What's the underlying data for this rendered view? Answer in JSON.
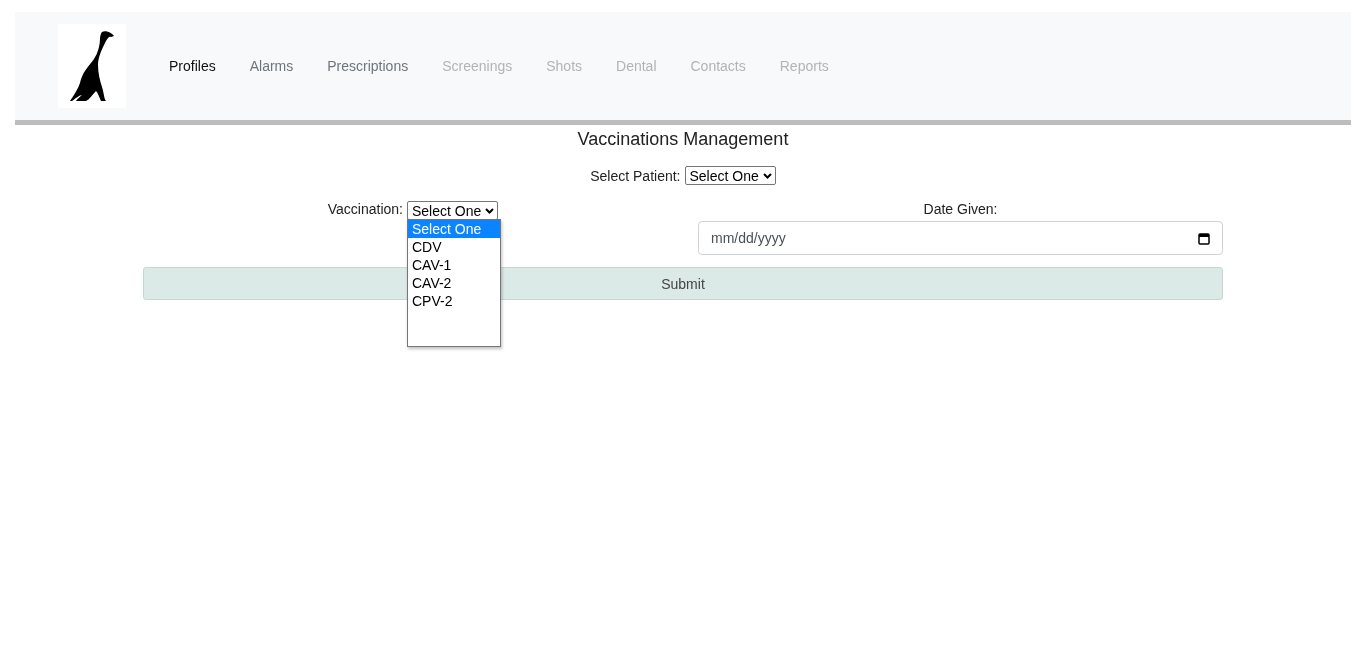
{
  "nav": {
    "items": [
      {
        "label": "Profiles",
        "selected": true,
        "disabled": false
      },
      {
        "label": "Alarms",
        "selected": false,
        "disabled": false
      },
      {
        "label": "Prescriptions",
        "selected": false,
        "disabled": false
      },
      {
        "label": "Screenings",
        "selected": false,
        "disabled": true
      },
      {
        "label": "Shots",
        "selected": false,
        "disabled": true
      },
      {
        "label": "Dental",
        "selected": false,
        "disabled": true
      },
      {
        "label": "Contacts",
        "selected": false,
        "disabled": true
      },
      {
        "label": "Reports",
        "selected": false,
        "disabled": true
      }
    ]
  },
  "title": "Vaccinations Management",
  "patient": {
    "label": "Select Patient:",
    "value": "Select One"
  },
  "vaccination": {
    "label": "Vaccination:",
    "value": "Select One",
    "expanded": true,
    "options": [
      {
        "label": "Select One",
        "selected": true
      },
      {
        "label": "CDV",
        "selected": false
      },
      {
        "label": "CAV-1",
        "selected": false
      },
      {
        "label": "CAV-2",
        "selected": false
      },
      {
        "label": "CPV-2",
        "selected": false
      }
    ]
  },
  "date": {
    "label": "Date Given:",
    "placeholder": "mm/dd/yyyy"
  },
  "submit": "Submit"
}
